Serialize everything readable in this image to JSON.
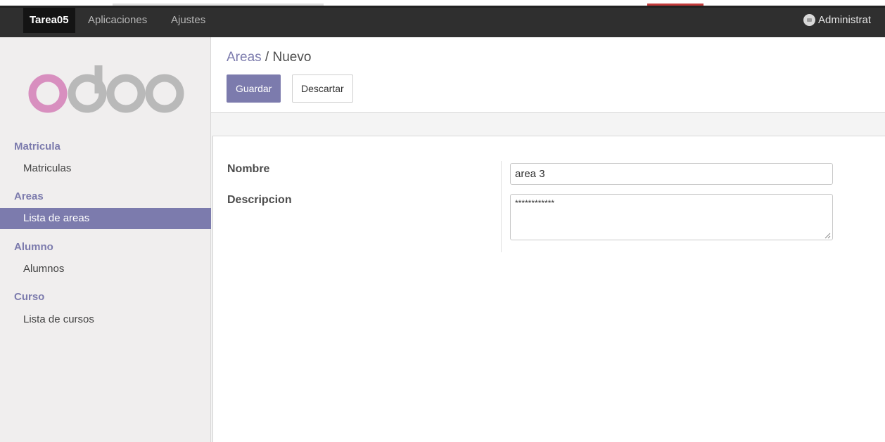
{
  "navbar": {
    "app_title": "Tarea05",
    "menu": [
      "Aplicaciones",
      "Ajustes"
    ],
    "user": "Administrat"
  },
  "sidebar": {
    "logo": "odoo",
    "sections": [
      {
        "title": "Matricula",
        "items": [
          {
            "label": "Matriculas",
            "active": false
          }
        ]
      },
      {
        "title": "Areas",
        "items": [
          {
            "label": "Lista de areas",
            "active": true
          }
        ]
      },
      {
        "title": "Alumno",
        "items": [
          {
            "label": "Alumnos",
            "active": false
          }
        ]
      },
      {
        "title": "Curso",
        "items": [
          {
            "label": "Lista de cursos",
            "active": false
          }
        ]
      }
    ]
  },
  "control_panel": {
    "breadcrumb": {
      "parent": "Areas",
      "separator": "/",
      "current": "Nuevo"
    },
    "buttons": {
      "save": "Guardar",
      "discard": "Descartar"
    }
  },
  "form": {
    "fields": {
      "nombre": {
        "label": "Nombre",
        "value": "area 3"
      },
      "descripcion": {
        "label": "Descripcion",
        "value": "************"
      }
    }
  },
  "colors": {
    "accent": "#7c7bad",
    "navbar": "#2f2f2f",
    "sidebar_bg": "#f0eeee"
  },
  "icons": {
    "user_avatar": "user-avatar-icon",
    "resize": "resize-grip-icon"
  }
}
